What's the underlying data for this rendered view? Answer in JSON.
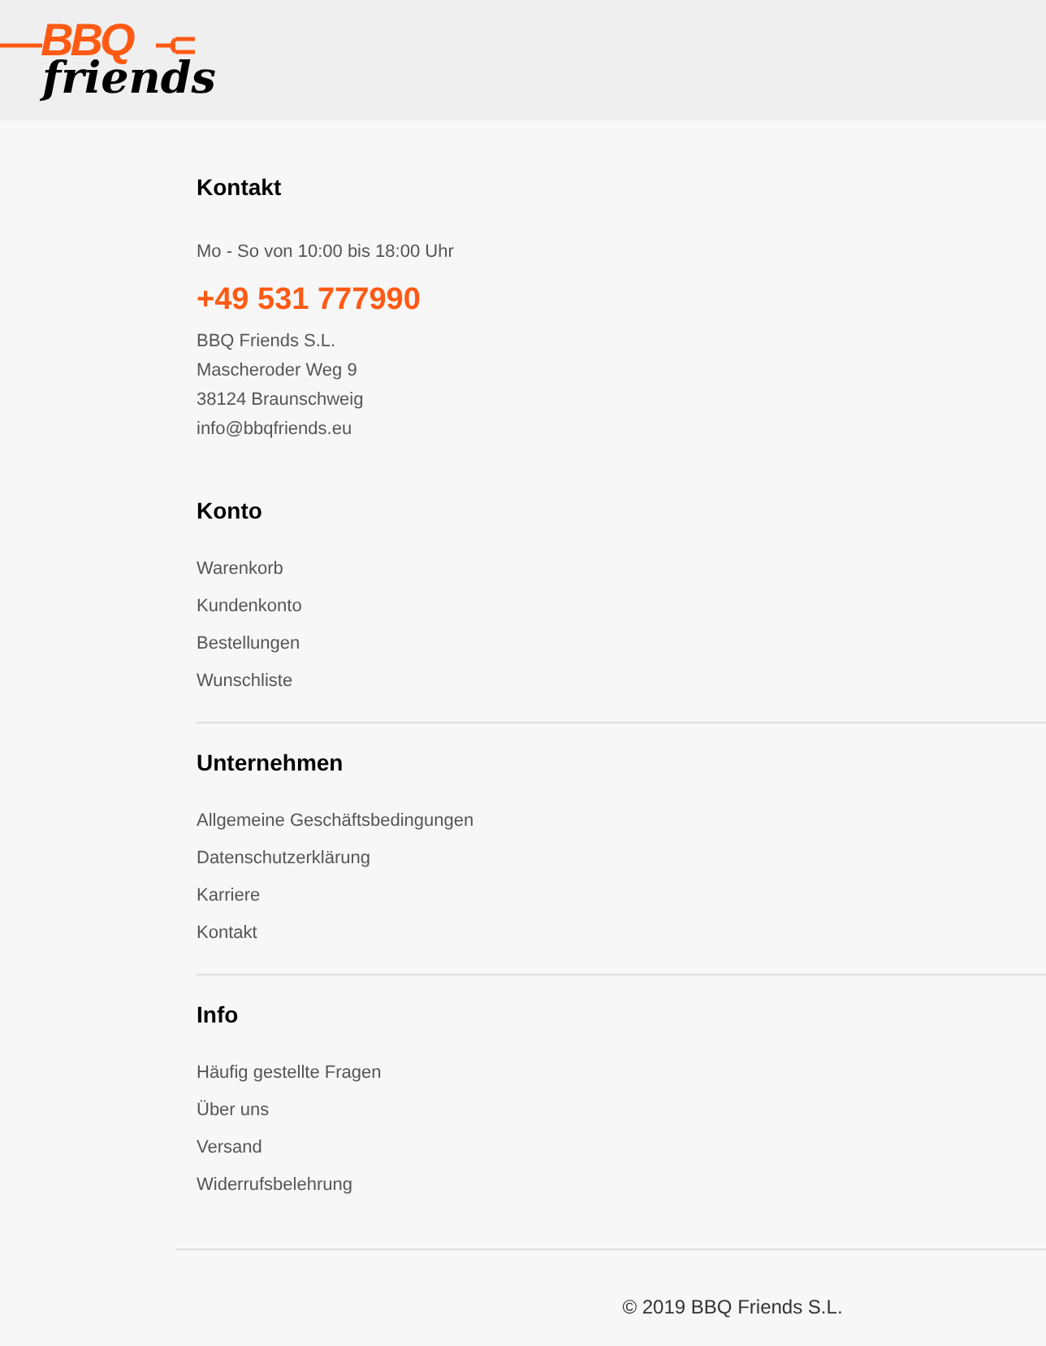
{
  "logo": {
    "brand": "BBQ",
    "tagline": "friends"
  },
  "contact": {
    "title": "Kontakt",
    "hours": "Mo - So von 10:00 bis 18:00 Uhr",
    "phone": "+49 531 777990",
    "address": [
      "BBQ Friends S.L.",
      "Mascheroder Weg 9",
      "38124 Braunschweig",
      "info@bbqfriends.eu"
    ]
  },
  "sections": [
    {
      "title": "Konto",
      "links": [
        "Warenkorb",
        "Kundenkonto",
        "Bestellungen",
        "Wunschliste"
      ]
    },
    {
      "title": "Unternehmen",
      "links": [
        "Allgemeine Geschäftsbedingungen",
        "Datenschutzerklärung",
        "Karriere",
        "Kontakt"
      ]
    },
    {
      "title": "Info",
      "links": [
        "Häufig gestellte Fragen",
        "Über uns",
        "Versand",
        "Widerrufsbelehrung"
      ]
    }
  ],
  "copyright": "© 2019 BBQ Friends S.L."
}
